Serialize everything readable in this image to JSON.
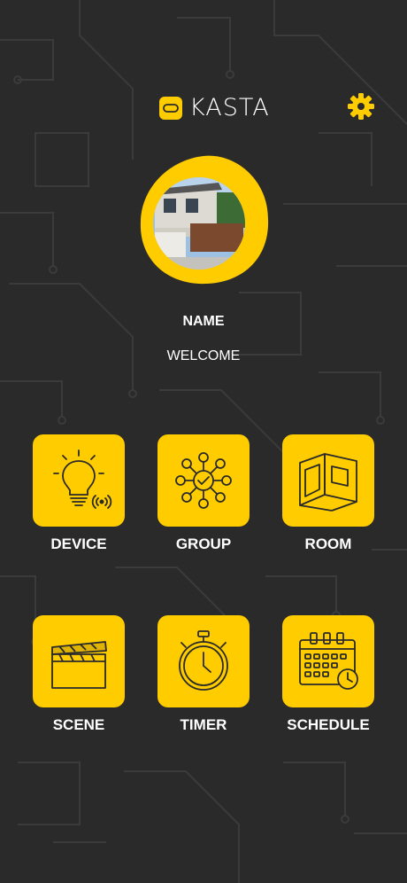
{
  "header": {
    "brand": "KASTA",
    "logo_icon": "infinity-link-icon",
    "settings_icon": "gear-icon"
  },
  "profile": {
    "name": "NAME",
    "welcome": "WELCOME",
    "image": "house-photo"
  },
  "tiles": [
    {
      "label": "DEVICE",
      "icon": "lightbulb-icon"
    },
    {
      "label": "GROUP",
      "icon": "network-hub-icon"
    },
    {
      "label": "ROOM",
      "icon": "room-cube-icon"
    },
    {
      "label": "SCENE",
      "icon": "clapperboard-icon"
    },
    {
      "label": "TIMER",
      "icon": "stopwatch-icon"
    },
    {
      "label": "SCHEDULE",
      "icon": "calendar-clock-icon"
    }
  ],
  "colors": {
    "accent": "#ffcc00",
    "background": "#2a2a2b",
    "text": "#ffffff"
  }
}
